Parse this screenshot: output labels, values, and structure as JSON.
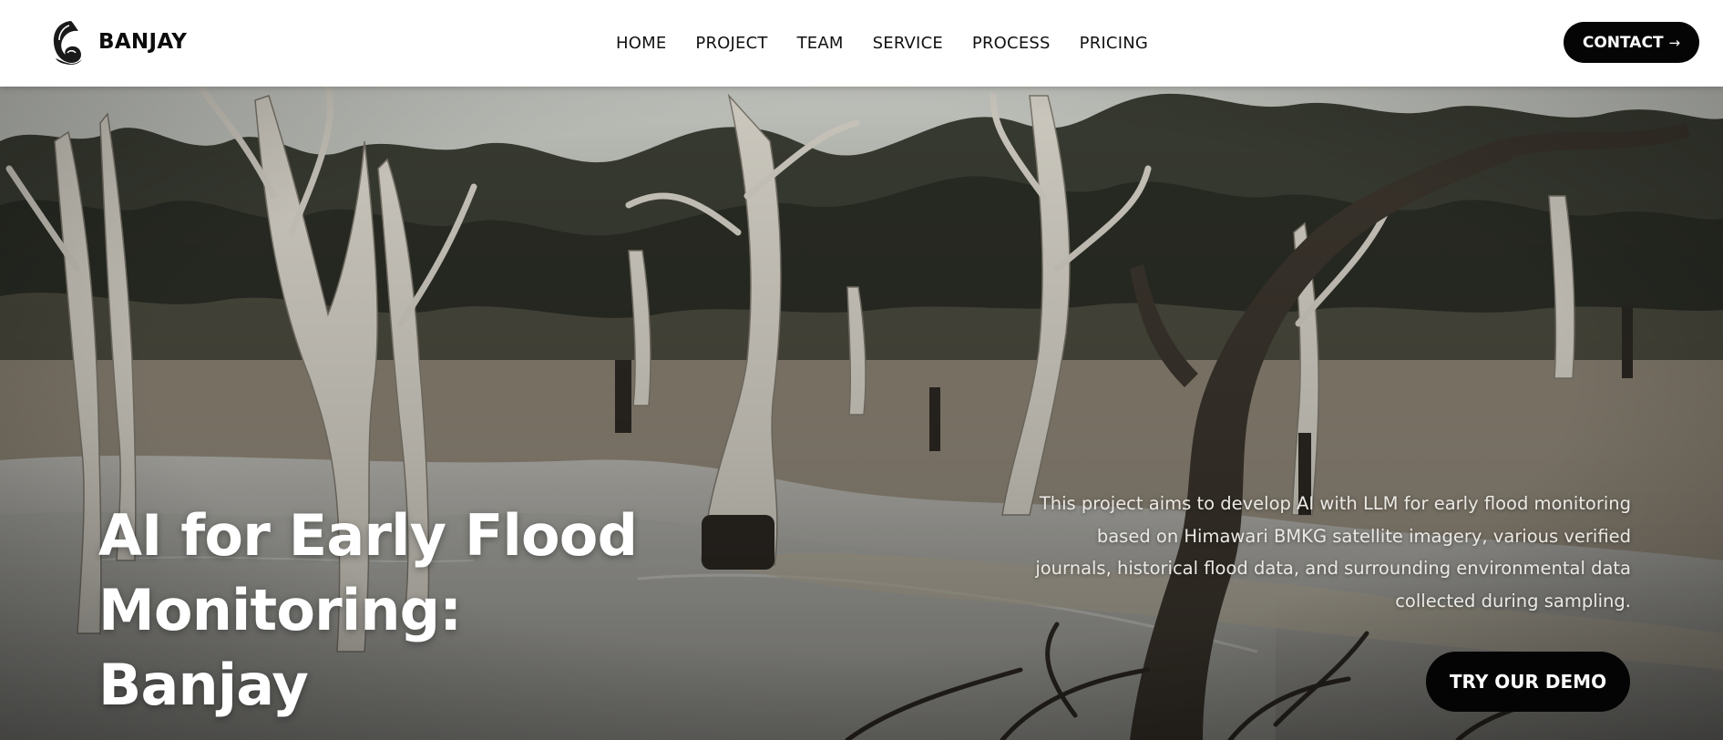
{
  "brand": {
    "name": "BANJAY",
    "logo_icon": "wave-logo-icon"
  },
  "nav": {
    "items": [
      {
        "label": "HOME"
      },
      {
        "label": "PROJECT"
      },
      {
        "label": "TEAM"
      },
      {
        "label": "SERVICE"
      },
      {
        "label": "PROCESS"
      },
      {
        "label": "PRICING"
      }
    ],
    "contact_label": "CONTACT",
    "contact_icon": "arrow-right-icon"
  },
  "hero": {
    "title_lines": [
      "AI for Early Flood",
      "Monitoring:",
      "Banjay"
    ],
    "description": "This project aims to develop AI with LLM for early flood monitoring based on Himawari BMKG satellite imagery, various verified journals, historical flood data, and surrounding environmental data collected during sampling.",
    "cta_label": "TRY OUR DEMO",
    "background": "flooded-forest-dead-trees-photo"
  },
  "colors": {
    "nav_bg": "#ffffff",
    "button_bg": "#040404",
    "button_text": "#ffffff",
    "hero_text": "#ffffff"
  }
}
